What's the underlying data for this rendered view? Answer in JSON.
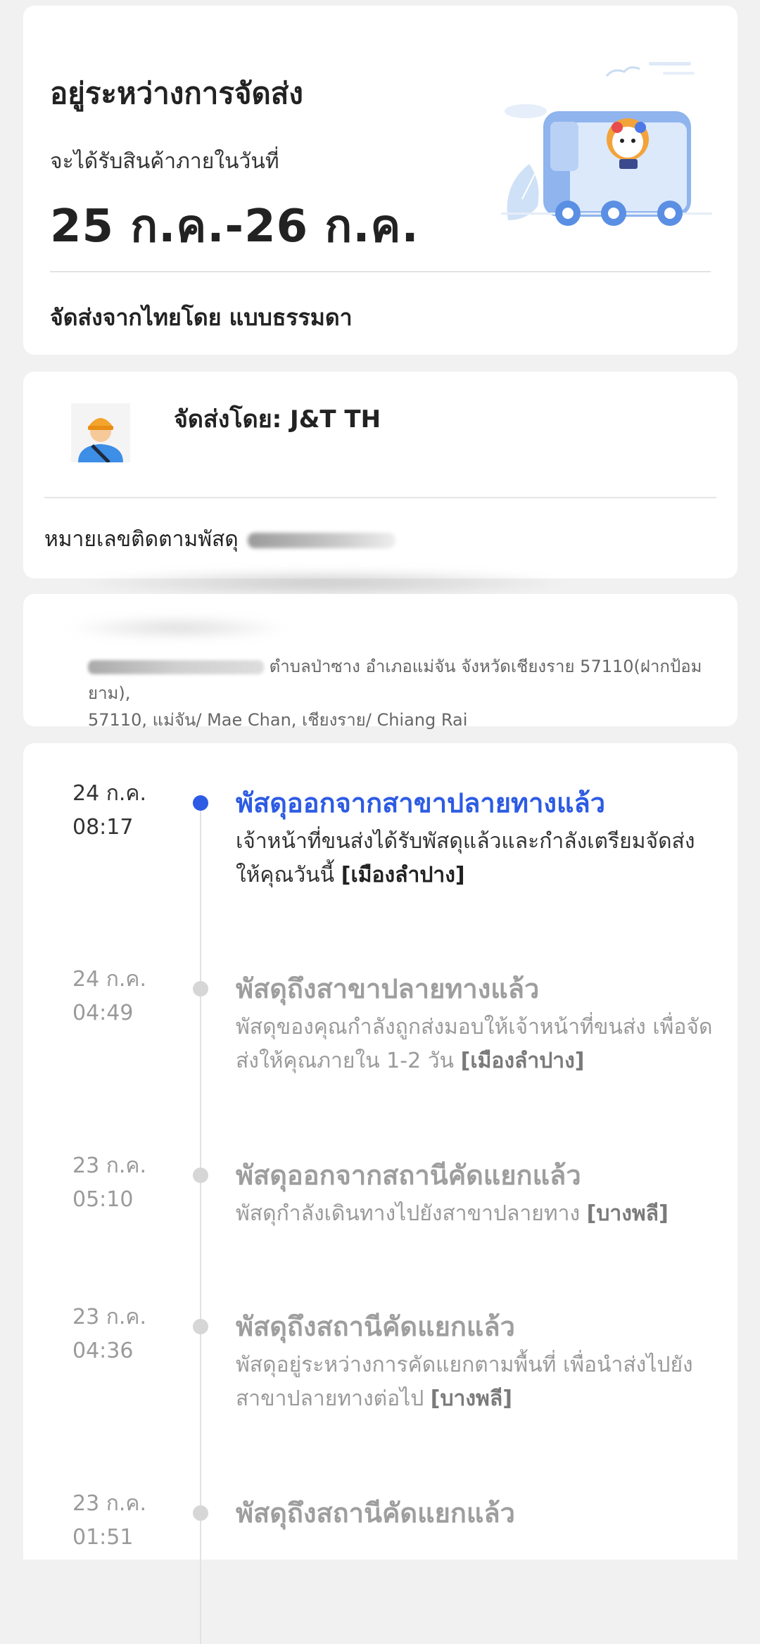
{
  "status_card": {
    "title": "อยู่ระหว่างการจัดส่ง",
    "subtitle": "จะได้รับสินค้าภายในวันที่",
    "date_range": "25 ก.ค.-26 ก.ค.",
    "method": "จัดส่งจากไทยโดย แบบธรรมดา",
    "illustration": "delivery-truck-icon"
  },
  "carrier_card": {
    "carrier_label": "จัดส่งโดย: J&T TH",
    "avatar": "courier-avatar-icon",
    "tracking_label": "หมายเลขติดตามพัสดุ"
  },
  "address_card": {
    "address_line": "ตำบลป่าซาง อำเภอแม่จัน จังหวัดเชียงราย 57110(ฝากป้อมยาม),",
    "address_line2": "57110, แม่จัน/ Mae Chan, เชียงราย/ Chiang Rai"
  },
  "timeline": [
    {
      "date": "24 ก.ค.",
      "time": "08:17",
      "title": "พัสดุออกจากสาขาปลายทางแล้ว",
      "desc": "เจ้าหน้าที่ขนส่งได้รับพัสดุแล้วและกำลังเตรียมจัดส่งให้คุณวันนี้ ",
      "location": "[เมืองลำปาง]",
      "active": true
    },
    {
      "date": "24 ก.ค.",
      "time": "04:49",
      "title": "พัสดุถึงสาขาปลายทางแล้ว",
      "desc": "พัสดุของคุณกำลังถูกส่งมอบให้เจ้าหน้าที่ขนส่ง เพื่อจัดส่งให้คุณภายใน 1-2 วัน ",
      "location": "[เมืองลำปาง]",
      "active": false
    },
    {
      "date": "23 ก.ค.",
      "time": "05:10",
      "title": "พัสดุออกจากสถานีคัดแยกแล้ว",
      "desc": "พัสดุกำลังเดินทางไปยังสาขาปลายทาง ",
      "location": "[บางพลี]",
      "active": false
    },
    {
      "date": "23 ก.ค.",
      "time": "04:36",
      "title": "พัสดุถึงสถานีคัดแยกแล้ว",
      "desc": "พัสดุอยู่ระหว่างการคัดแยกตามพื้นที่ เพื่อนำส่งไปยังสาขาปลายทางต่อไป ",
      "location": "[บางพลี]",
      "active": false
    },
    {
      "date": "23 ก.ค.",
      "time": "01:51",
      "title": "พัสดุถึงสถานีคัดแยกแล้ว",
      "desc": "",
      "location": "",
      "active": false
    }
  ]
}
